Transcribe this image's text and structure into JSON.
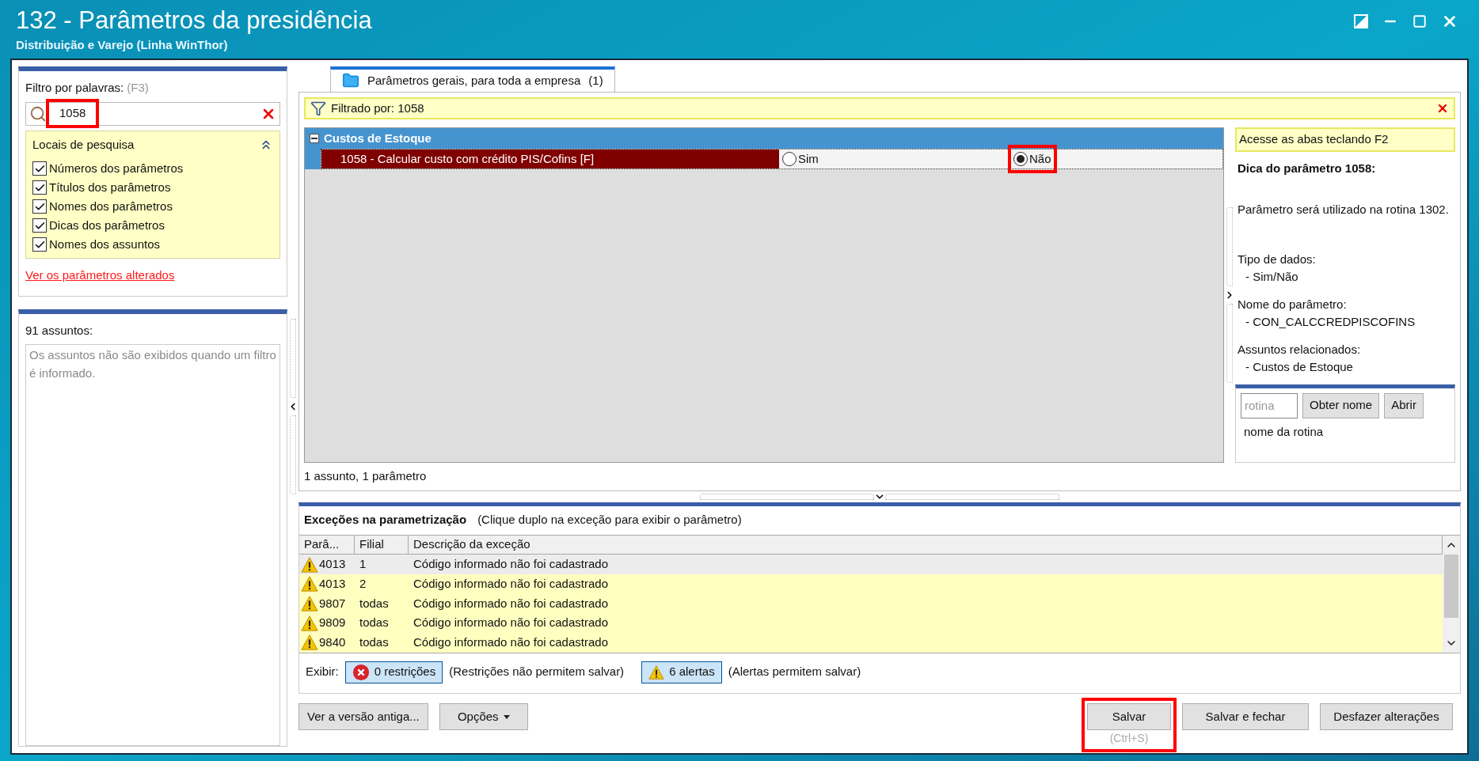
{
  "window": {
    "title": "132 - Parâmetros da presidência",
    "subtitle": "Distribuição e Varejo (Linha WinThor)"
  },
  "filter_panel": {
    "label": "Filtro por palavras:",
    "shortcut": "(F3)",
    "search": {
      "value": "1058",
      "highlighted": true
    },
    "search_locations": {
      "title": "Locais de pesquisa",
      "expanded": true,
      "options": [
        {
          "label": "Números dos parâmetros",
          "checked": true
        },
        {
          "label": "Títulos dos parâmetros",
          "checked": true
        },
        {
          "label": "Nomes dos parâmetros",
          "checked": true
        },
        {
          "label": "Dicas dos parâmetros",
          "checked": true
        },
        {
          "label": "Nomes dos assuntos",
          "checked": true
        }
      ]
    },
    "link": "Ver os parâmetros alterados"
  },
  "subjects_panel": {
    "title": "91 assuntos:",
    "message": "Os assuntos não são exibidos quando um filtro é informado."
  },
  "tabs": [
    {
      "label": "Parâmetros gerais, para toda a empresa",
      "count": "(1)",
      "selected": true
    }
  ],
  "filter_bar": {
    "text": "Filtrado por: 1058"
  },
  "tree": {
    "groups": [
      {
        "title": "Custos de Estoque",
        "expanded": true,
        "parameters": [
          {
            "label": "1058 - Calcular custo com crédito PIS/Cofins [F]",
            "selected": true,
            "options": [
              {
                "label": "Sim",
                "selected": false,
                "highlighted": false
              },
              {
                "label": "Não",
                "selected": true,
                "highlighted": true
              }
            ]
          }
        ]
      }
    ]
  },
  "tree_status": "1 assunto, 1 parâmetro",
  "hint_panel": {
    "banner": "Acesse as abas teclando F2",
    "title": "Dica do parâmetro 1058:",
    "description": "Parâmetro será utilizado na rotina 1302.",
    "sections": [
      {
        "heading": "Tipo de dados:",
        "value": "- Sim/Não"
      },
      {
        "heading": "Nome do parâmetro:",
        "value": "- CON_CALCCREDPISCOFINS"
      },
      {
        "heading": "Assuntos relacionados:",
        "value": "- Custos de Estoque"
      }
    ]
  },
  "routine_lookup": {
    "placeholder": "rotina",
    "buttons": [
      "Obter nome",
      "Abrir"
    ],
    "result": "nome da rotina"
  },
  "exceptions": {
    "title": "Exceções na parametrização",
    "hint": "(Clique duplo na exceção para exibir o parâmetro)",
    "columns": [
      "Parâ...",
      "Filial",
      "Descrição da exceção"
    ],
    "rows": [
      {
        "cells": [
          "4013",
          "1",
          "Código informado não foi cadastrado"
        ],
        "selected": true
      },
      {
        "cells": [
          "4013",
          "2",
          "Código informado não foi cadastrado"
        ],
        "selected": false
      },
      {
        "cells": [
          "9807",
          "todas",
          "Código informado não foi cadastrado"
        ],
        "selected": false
      },
      {
        "cells": [
          "9809",
          "todas",
          "Código informado não foi cadastrado"
        ],
        "selected": false
      },
      {
        "cells": [
          "9840",
          "todas",
          "Código informado não foi cadastrado"
        ],
        "selected": false
      }
    ],
    "show_label": "Exibir:",
    "toggles": [
      {
        "kind": "error",
        "label": "0 restrições",
        "pressed": true,
        "note": "(Restrições não permitem salvar)"
      },
      {
        "kind": "warning",
        "label": "6 alertas",
        "pressed": true,
        "note": "(Alertas permitem salvar)"
      }
    ]
  },
  "footer": {
    "left_buttons": [
      {
        "label": "Ver a versão antiga...",
        "menu": false
      },
      {
        "label": "Opções",
        "menu": true
      }
    ],
    "right_buttons": [
      {
        "label": "Salvar",
        "shortcut": "(Ctrl+S)",
        "highlighted": true
      },
      {
        "label": "Salvar e fechar",
        "highlighted": false
      },
      {
        "label": "Desfazer alterações",
        "highlighted": false
      }
    ]
  }
}
